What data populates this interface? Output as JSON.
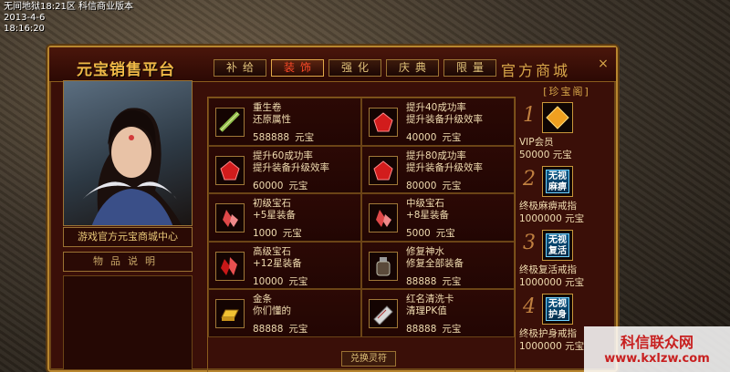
{
  "system": {
    "server": "无间地狱18:21区 科信商业版本",
    "date": "2013-4-6",
    "time": "18:16:20"
  },
  "window": {
    "title": "元宝销售平台",
    "mall_label": "官方商城",
    "close_glyph": "×"
  },
  "tabs": [
    {
      "label": "补给",
      "active": false
    },
    {
      "label": "装饰",
      "active": true
    },
    {
      "label": "强化",
      "active": false
    },
    {
      "label": "庆典",
      "active": false
    },
    {
      "label": "限量",
      "active": false
    }
  ],
  "left": {
    "caption": "游戏官方元宝商城中心",
    "desc_header": "物品说明"
  },
  "items": [
    {
      "name": "重生卷",
      "desc": "还原属性",
      "price": "588888",
      "unit": "元宝",
      "icon": "scroll-icon"
    },
    {
      "name": "提升40成功率",
      "desc": "提升装备升级效率",
      "price": "40000",
      "unit": "元宝",
      "icon": "red-gem-icon"
    },
    {
      "name": "提升60成功率",
      "desc": "提升装备升级效率",
      "price": "60000",
      "unit": "元宝",
      "icon": "red-gem-icon"
    },
    {
      "name": "提升80成功率",
      "desc": "提升装备升级效率",
      "price": "80000",
      "unit": "元宝",
      "icon": "red-gem-icon"
    },
    {
      "name": "初级宝石",
      "desc": "+5星装备",
      "price": "1000",
      "unit": "元宝",
      "icon": "crystal-icon"
    },
    {
      "name": "中级宝石",
      "desc": "+8星装备",
      "price": "5000",
      "unit": "元宝",
      "icon": "crystal-icon"
    },
    {
      "name": "高级宝石",
      "desc": "+12星装备",
      "price": "10000",
      "unit": "元宝",
      "icon": "crystal-icon"
    },
    {
      "name": "修复神水",
      "desc": "修复全部装备",
      "price": "88888",
      "unit": "元宝",
      "icon": "potion-icon"
    },
    {
      "name": "金条",
      "desc": "你们懂的",
      "price": "88888",
      "unit": "元宝",
      "icon": "gold-bar-icon"
    },
    {
      "name": "红名清洗卡",
      "desc": "清理PK值",
      "price": "88888",
      "unit": "元宝",
      "icon": "card-icon"
    }
  ],
  "sidebar": {
    "header": "[珍宝阁]",
    "items": [
      {
        "num": "1",
        "name": "VIP会员",
        "price": "50000",
        "unit": "元宝",
        "badge": ""
      },
      {
        "num": "2",
        "name": "终极麻痹戒指",
        "price": "1000000",
        "unit": "元宝",
        "badge": "无视麻痹"
      },
      {
        "num": "3",
        "name": "终极复活戒指",
        "price": "1000000",
        "unit": "元宝",
        "badge": "无视复活"
      },
      {
        "num": "4",
        "name": "终极护身戒指",
        "price": "1000000",
        "unit": "元宝",
        "badge": "无视护身"
      }
    ],
    "last_price": "1000000"
  },
  "bottom_button": "兑换灵符",
  "watermark": {
    "name": "科信联众网",
    "url": "www.kxlzw.com"
  }
}
